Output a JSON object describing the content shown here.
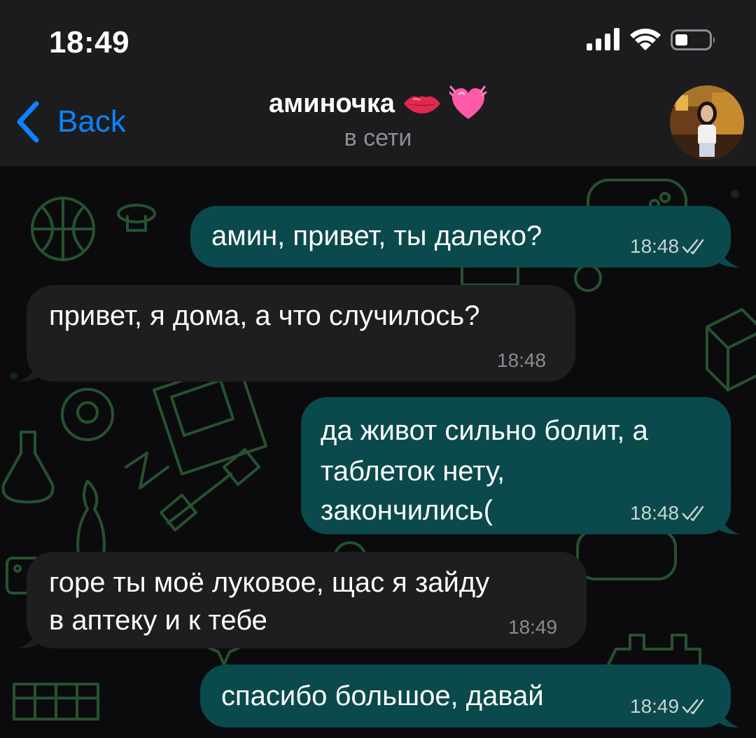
{
  "status_bar": {
    "time": "18:49"
  },
  "header": {
    "back_label": "Back",
    "chat_name": "аминочка",
    "chat_status": "в сети"
  },
  "icons": {
    "signal": "cellular-signal-icon",
    "wifi": "wifi-icon",
    "battery": "battery-icon",
    "back": "chevron-left-icon",
    "read_receipt": "double-check-icon"
  },
  "colors": {
    "accent": "#0a84ff",
    "outgoing_bubble": "#0b4a4c",
    "incoming_bubble": "#1e1e20",
    "wallpaper_doodle": "#2f6a3a"
  },
  "messages": [
    {
      "direction": "outgoing",
      "text": "амин, привет, ты далеко?",
      "time": "18:48",
      "read": true
    },
    {
      "direction": "incoming",
      "text": "привет, я дома, а что случилось?",
      "time": "18:48"
    },
    {
      "direction": "outgoing",
      "lines": [
        "да живот сильно болит, а",
        "таблеток нету,",
        "закончились("
      ],
      "time": "18:48",
      "read": true
    },
    {
      "direction": "incoming",
      "lines": [
        "горе ты моё луковое, щас я зайду",
        "в аптеку и к тебе"
      ],
      "time": "18:49"
    },
    {
      "direction": "outgoing",
      "text": "спасибо большое, давай",
      "time": "18:49",
      "read": true
    }
  ]
}
